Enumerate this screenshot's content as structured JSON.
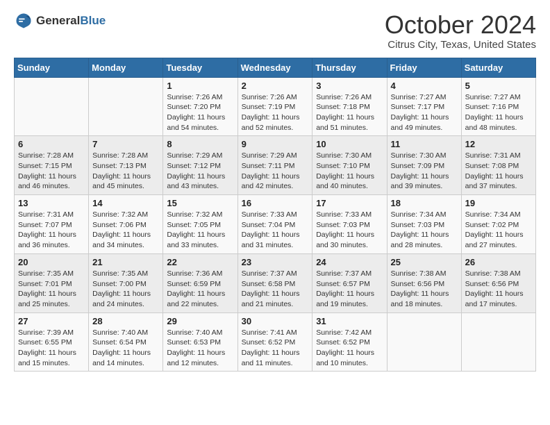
{
  "logo": {
    "general": "General",
    "blue": "Blue"
  },
  "header": {
    "month": "October 2024",
    "location": "Citrus City, Texas, United States"
  },
  "days_of_week": [
    "Sunday",
    "Monday",
    "Tuesday",
    "Wednesday",
    "Thursday",
    "Friday",
    "Saturday"
  ],
  "weeks": [
    [
      {
        "day": "",
        "info": ""
      },
      {
        "day": "",
        "info": ""
      },
      {
        "day": "1",
        "info": "Sunrise: 7:26 AM\nSunset: 7:20 PM\nDaylight: 11 hours and 54 minutes."
      },
      {
        "day": "2",
        "info": "Sunrise: 7:26 AM\nSunset: 7:19 PM\nDaylight: 11 hours and 52 minutes."
      },
      {
        "day": "3",
        "info": "Sunrise: 7:26 AM\nSunset: 7:18 PM\nDaylight: 11 hours and 51 minutes."
      },
      {
        "day": "4",
        "info": "Sunrise: 7:27 AM\nSunset: 7:17 PM\nDaylight: 11 hours and 49 minutes."
      },
      {
        "day": "5",
        "info": "Sunrise: 7:27 AM\nSunset: 7:16 PM\nDaylight: 11 hours and 48 minutes."
      }
    ],
    [
      {
        "day": "6",
        "info": "Sunrise: 7:28 AM\nSunset: 7:15 PM\nDaylight: 11 hours and 46 minutes."
      },
      {
        "day": "7",
        "info": "Sunrise: 7:28 AM\nSunset: 7:13 PM\nDaylight: 11 hours and 45 minutes."
      },
      {
        "day": "8",
        "info": "Sunrise: 7:29 AM\nSunset: 7:12 PM\nDaylight: 11 hours and 43 minutes."
      },
      {
        "day": "9",
        "info": "Sunrise: 7:29 AM\nSunset: 7:11 PM\nDaylight: 11 hours and 42 minutes."
      },
      {
        "day": "10",
        "info": "Sunrise: 7:30 AM\nSunset: 7:10 PM\nDaylight: 11 hours and 40 minutes."
      },
      {
        "day": "11",
        "info": "Sunrise: 7:30 AM\nSunset: 7:09 PM\nDaylight: 11 hours and 39 minutes."
      },
      {
        "day": "12",
        "info": "Sunrise: 7:31 AM\nSunset: 7:08 PM\nDaylight: 11 hours and 37 minutes."
      }
    ],
    [
      {
        "day": "13",
        "info": "Sunrise: 7:31 AM\nSunset: 7:07 PM\nDaylight: 11 hours and 36 minutes."
      },
      {
        "day": "14",
        "info": "Sunrise: 7:32 AM\nSunset: 7:06 PM\nDaylight: 11 hours and 34 minutes."
      },
      {
        "day": "15",
        "info": "Sunrise: 7:32 AM\nSunset: 7:05 PM\nDaylight: 11 hours and 33 minutes."
      },
      {
        "day": "16",
        "info": "Sunrise: 7:33 AM\nSunset: 7:04 PM\nDaylight: 11 hours and 31 minutes."
      },
      {
        "day": "17",
        "info": "Sunrise: 7:33 AM\nSunset: 7:03 PM\nDaylight: 11 hours and 30 minutes."
      },
      {
        "day": "18",
        "info": "Sunrise: 7:34 AM\nSunset: 7:03 PM\nDaylight: 11 hours and 28 minutes."
      },
      {
        "day": "19",
        "info": "Sunrise: 7:34 AM\nSunset: 7:02 PM\nDaylight: 11 hours and 27 minutes."
      }
    ],
    [
      {
        "day": "20",
        "info": "Sunrise: 7:35 AM\nSunset: 7:01 PM\nDaylight: 11 hours and 25 minutes."
      },
      {
        "day": "21",
        "info": "Sunrise: 7:35 AM\nSunset: 7:00 PM\nDaylight: 11 hours and 24 minutes."
      },
      {
        "day": "22",
        "info": "Sunrise: 7:36 AM\nSunset: 6:59 PM\nDaylight: 11 hours and 22 minutes."
      },
      {
        "day": "23",
        "info": "Sunrise: 7:37 AM\nSunset: 6:58 PM\nDaylight: 11 hours and 21 minutes."
      },
      {
        "day": "24",
        "info": "Sunrise: 7:37 AM\nSunset: 6:57 PM\nDaylight: 11 hours and 19 minutes."
      },
      {
        "day": "25",
        "info": "Sunrise: 7:38 AM\nSunset: 6:56 PM\nDaylight: 11 hours and 18 minutes."
      },
      {
        "day": "26",
        "info": "Sunrise: 7:38 AM\nSunset: 6:56 PM\nDaylight: 11 hours and 17 minutes."
      }
    ],
    [
      {
        "day": "27",
        "info": "Sunrise: 7:39 AM\nSunset: 6:55 PM\nDaylight: 11 hours and 15 minutes."
      },
      {
        "day": "28",
        "info": "Sunrise: 7:40 AM\nSunset: 6:54 PM\nDaylight: 11 hours and 14 minutes."
      },
      {
        "day": "29",
        "info": "Sunrise: 7:40 AM\nSunset: 6:53 PM\nDaylight: 11 hours and 12 minutes."
      },
      {
        "day": "30",
        "info": "Sunrise: 7:41 AM\nSunset: 6:52 PM\nDaylight: 11 hours and 11 minutes."
      },
      {
        "day": "31",
        "info": "Sunrise: 7:42 AM\nSunset: 6:52 PM\nDaylight: 11 hours and 10 minutes."
      },
      {
        "day": "",
        "info": ""
      },
      {
        "day": "",
        "info": ""
      }
    ]
  ]
}
